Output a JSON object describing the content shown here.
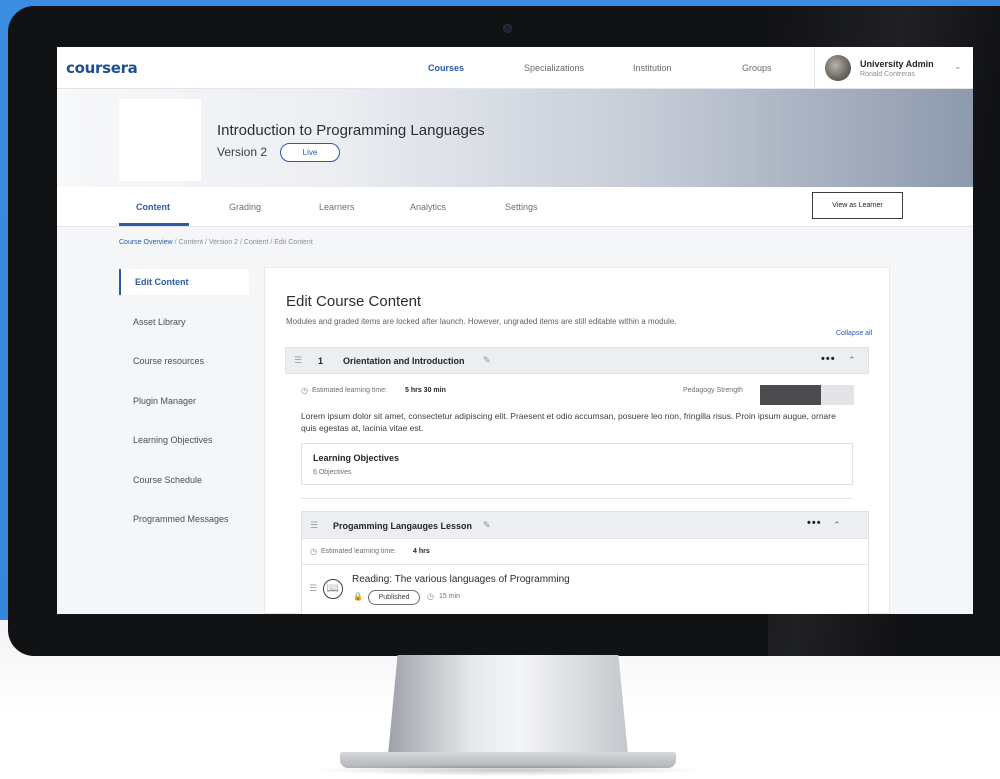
{
  "topnav": {
    "logo": "coursera",
    "links": [
      "Courses",
      "Specializations",
      "Institution",
      "Groups"
    ],
    "user_role": "University Admin",
    "user_name": "Ronald Contreras"
  },
  "hero": {
    "title": "Introduction to Programming Languages",
    "version": "Version 2",
    "status": "Live"
  },
  "tabs": [
    "Content",
    "Grading",
    "Learners",
    "Analytics",
    "Settings"
  ],
  "view_as_learner": "View as Learner",
  "breadcrumb": {
    "first": "Course Overview",
    "rest": " / Content / Version 2 / Content / Edit Content"
  },
  "sidebar": {
    "items": [
      "Edit Content",
      "Asset Library",
      "Course resources",
      "Plugin Manager",
      "Learning Objectives",
      "Course Schedule",
      "Programmed Messages"
    ]
  },
  "main": {
    "title": "Edit Course Content",
    "subtitle": "Modules and graded items are locked after launch. However, ungraded items are still editable within a module.",
    "collapse_all": "Collapse all",
    "module": {
      "number": "1",
      "name": "Orientation and Introduction",
      "est_label": "Estimated learning time:",
      "est_value": "5 hrs  30 min",
      "pedagogy_label": "Pedagogy Strength",
      "pedagogy_fraction": 0.65,
      "description": "Lorem ipsum dolor sit amet, consectetur adipiscing elit. Praesent et odio accumsan, posuere leo non, fringilla risus. Proin ipsum augue, ornare quis egestas at, lacinia vitae est.",
      "objectives_title": "Learning Objectives",
      "objectives_count": "6 Objectives"
    },
    "lesson": {
      "name": "Progamming Langauges Lesson",
      "est_label": "Estimated learning time:",
      "est_value": "4 hrs",
      "item_title": "Reading: The various languages of Programming",
      "item_status": "Published",
      "item_duration": "15 min"
    }
  },
  "colors": {
    "accent": "#2a5aa8",
    "backdrop": "#3a8de0"
  },
  "icons": [
    "camera-icon",
    "chevron-down-icon",
    "drag-handle-icon",
    "pencil-icon",
    "more-dots-icon",
    "caret-up-icon",
    "clock-icon",
    "book-icon",
    "lock-icon"
  ]
}
